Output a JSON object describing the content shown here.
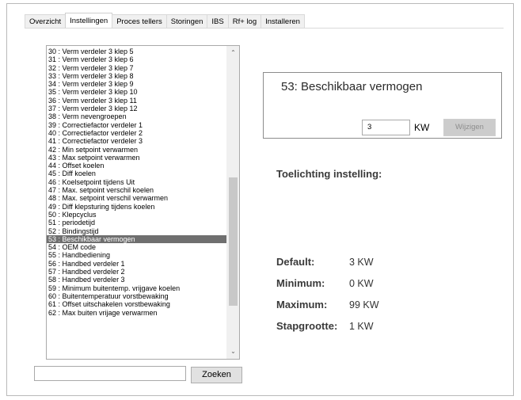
{
  "tabs": [
    "Overzicht",
    "Instellingen",
    "Proces tellers",
    "Storingen",
    "IBS",
    "Rf+ log",
    "Installeren"
  ],
  "active_tab": "Instellingen",
  "settings_list": [
    "30 : Verm verdeler 3 klep 5",
    "31 : Verm verdeler 3 klep 6",
    "32 : Verm verdeler 3 klep 7",
    "33 : Verm verdeler 3 klep 8",
    "34 : Verm verdeler 3 klep 9",
    "35 : Verm verdeler 3 klep 10",
    "36 : Verm verdeler 3 klep 11",
    "37 : Verm verdeler 3 klep 12",
    "38 : Verm nevengroepen",
    "39 : Correctiefactor verdeler 1",
    "40 : Correctiefactor verdeler 2",
    "41 : Correctiefactor verdeler 3",
    "42 : Min setpoint verwarmen",
    "43 : Max setpoint verwarmen",
    "44 : Offset koelen",
    "45 : Diff koelen",
    "46 : Koelsetpoint tijdens Uit",
    "47 : Max. setpoint verschil koelen",
    "48 : Max. setpoint verschil verwarmen",
    "49 : Diff klepsturing tijdens koelen",
    "50 : Klepcyclus",
    "51 : periodetijd",
    "52 : Bindingstijd",
    "53 : Beschikbaar vermogen",
    "54 : OEM code",
    "55 : Handbediening",
    "56 : Handbed verdeler 1",
    "57 : Handbed verdeler 2",
    "58 : Handbed verdeler 3",
    "59 : Minimum buitentemp. vrijgave koelen",
    "60 : Buitentemperatuur vorstbewaking",
    "61 : Offset uitschakelen vorstbewaking",
    "62 : Max buiten vrijage verwarmen"
  ],
  "selected_index": 23,
  "search": {
    "value": "",
    "button_label": "Zoeken"
  },
  "setting": {
    "title": "53: Beschikbaar vermogen",
    "value": "3",
    "unit": "KW",
    "change_label": "Wijzigen"
  },
  "explanation_label": "Toelichting instelling:",
  "stats": {
    "default_label": "Default:",
    "default_value": "3 KW",
    "minimum_label": "Minimum:",
    "minimum_value": "0 KW",
    "maximum_label": "Maximum:",
    "maximum_value": "99 KW",
    "step_label": "Stapgrootte:",
    "step_value": "1 KW"
  },
  "scroll_icons": {
    "up": "chevron-up-icon",
    "down": "chevron-down-icon"
  }
}
